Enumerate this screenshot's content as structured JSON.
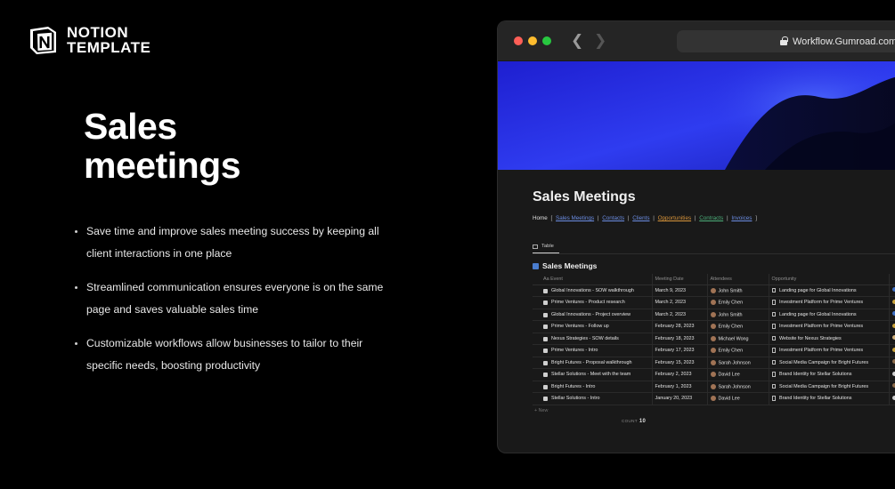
{
  "brand": {
    "line1": "NOTION",
    "line2": "TEMPLATE"
  },
  "headline": {
    "line1": "Sales",
    "line2": "meetings"
  },
  "bullets": [
    "Save time and improve sales meeting success by keeping all client interactions in one place",
    "Streamlined communication ensures everyone is on the same page and saves valuable sales time",
    "Customizable workflows allow businesses to tailor to their specific needs, boosting productivity"
  ],
  "browser": {
    "url": "Workflow.Gumroad.com"
  },
  "page": {
    "title": "Sales Meetings",
    "breadcrumb": {
      "home": "Home",
      "links": [
        "Sales Meetings",
        "Contacts",
        "Clients",
        "Opportunities",
        "Contracts",
        "Invoices"
      ],
      "link_colors": [
        "#6b8de3",
        "#6b8de3",
        "#6b8de3",
        "#d9953a",
        "#4caf7a",
        "#6b8de3"
      ]
    },
    "view_tab": "Table",
    "database_title": "Sales Meetings",
    "columns": {
      "event": "Aa Event",
      "date": "Meeting Date",
      "attendees": "Attendees",
      "opportunity": "Opportunity"
    },
    "rows": [
      {
        "event": "Global Innovations - SOW walkthrough",
        "date": "March 9, 2023",
        "attendee": "John Smith",
        "opportunity": "Landing page for Global Innovations"
      },
      {
        "event": "Prime Ventures - Product research",
        "date": "March 2, 2023",
        "attendee": "Emily Chen",
        "opportunity": "Investment Platform for Prime Ventures"
      },
      {
        "event": "Global Innovations - Project overview",
        "date": "March 2, 2023",
        "attendee": "John Smith",
        "opportunity": "Landing page for Global Innovations"
      },
      {
        "event": "Prime Ventures - Follow up",
        "date": "February 28, 2023",
        "attendee": "Emily Chen",
        "opportunity": "Investment Platform for Prime Ventures"
      },
      {
        "event": "Nexus Strategies - SOW details",
        "date": "February 18, 2023",
        "attendee": "Michael Wong",
        "opportunity": "Website for Nexus Strategies"
      },
      {
        "event": "Prime Ventures - Intro",
        "date": "February 17, 2023",
        "attendee": "Emily Chen",
        "opportunity": "Investment Platform for Prime Ventures"
      },
      {
        "event": "Bright Futures - Proposal walkthrough",
        "date": "February 15, 2023",
        "attendee": "Sarah Johnson",
        "opportunity": "Social Media Campaign for Bright Futures"
      },
      {
        "event": "Stellar Solutions - Meet with the team",
        "date": "February 2, 2023",
        "attendee": "David Lee",
        "opportunity": "Brand Identity for Stellar Solutions"
      },
      {
        "event": "Bright Futures - Intro",
        "date": "February 1, 2023",
        "attendee": "Sarah Johnson",
        "opportunity": "Social Media Campaign for Bright Futures"
      },
      {
        "event": "Stellar Solutions - Intro",
        "date": "January 20, 2023",
        "attendee": "David Lee",
        "opportunity": "Brand Identity for Stellar Solutions"
      }
    ],
    "new_label": "+ New",
    "count_label": "COUNT",
    "count_value": "10"
  },
  "colors": {
    "background": "#000000",
    "cover_blue": "#2b35e6",
    "accent_blue": "#4a7dcf"
  }
}
